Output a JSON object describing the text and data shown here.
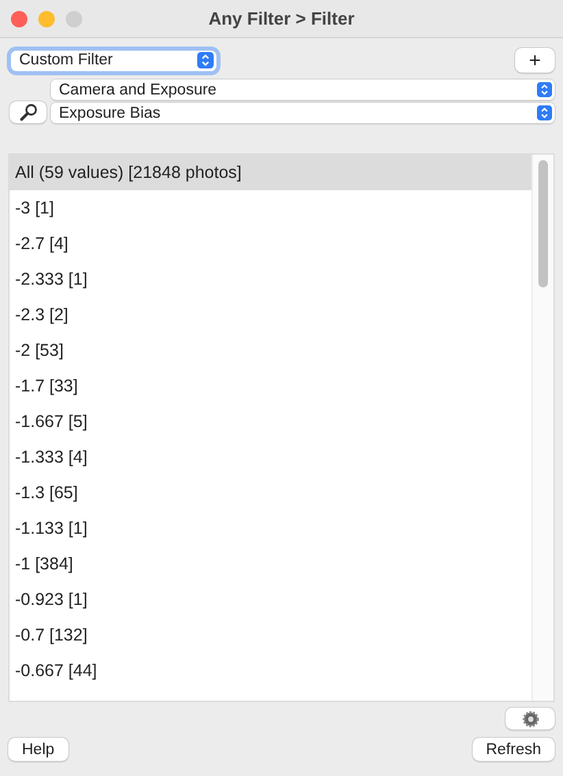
{
  "window": {
    "title": "Any Filter > Filter"
  },
  "filter_preset": {
    "value": "Custom Filter"
  },
  "add_button": {
    "label": "+"
  },
  "category_select": {
    "value": "Camera and Exposure"
  },
  "field_select": {
    "value": "Exposure Bias"
  },
  "values_list": [
    {
      "label": "All (59 values) [21848 photos]",
      "selected": true
    },
    {
      "label": "-3 [1]",
      "selected": false
    },
    {
      "label": "-2.7 [4]",
      "selected": false
    },
    {
      "label": "-2.333 [1]",
      "selected": false
    },
    {
      "label": "-2.3 [2]",
      "selected": false
    },
    {
      "label": "-2 [53]",
      "selected": false
    },
    {
      "label": "-1.7 [33]",
      "selected": false
    },
    {
      "label": "-1.667 [5]",
      "selected": false
    },
    {
      "label": "-1.333 [4]",
      "selected": false
    },
    {
      "label": "-1.3 [65]",
      "selected": false
    },
    {
      "label": "-1.133 [1]",
      "selected": false
    },
    {
      "label": "-1 [384]",
      "selected": false
    },
    {
      "label": "-0.923 [1]",
      "selected": false
    },
    {
      "label": "-0.7 [132]",
      "selected": false
    },
    {
      "label": "-0.667 [44]",
      "selected": false
    }
  ],
  "buttons": {
    "help": "Help",
    "refresh": "Refresh"
  }
}
